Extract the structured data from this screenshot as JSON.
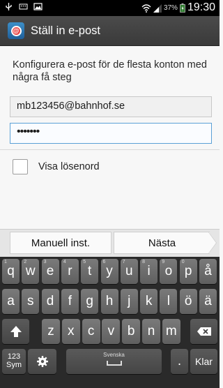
{
  "status_bar": {
    "battery": "37%",
    "time": "19:30"
  },
  "action_bar": {
    "title": "Ställ in e-post",
    "app_icon": "email-app-icon"
  },
  "content": {
    "intro": "Konfigurera e-post för de flesta konton med några få steg",
    "email_value": "mb123456@bahnhof.se",
    "password_value": "•••••••",
    "show_password_label": "Visa lösenord"
  },
  "buttons": {
    "manual": "Manuell inst.",
    "next": "Nästa"
  },
  "keyboard": {
    "row1": [
      {
        "label": "q",
        "num": "1"
      },
      {
        "label": "w",
        "num": "2"
      },
      {
        "label": "e",
        "num": "3"
      },
      {
        "label": "r",
        "num": "4"
      },
      {
        "label": "t",
        "num": "5"
      },
      {
        "label": "y",
        "num": "6"
      },
      {
        "label": "u",
        "num": "7"
      },
      {
        "label": "i",
        "num": "8"
      },
      {
        "label": "o",
        "num": "9"
      },
      {
        "label": "p",
        "num": "0"
      },
      {
        "label": "å",
        "num": ""
      }
    ],
    "row2": [
      "a",
      "s",
      "d",
      "f",
      "g",
      "h",
      "j",
      "k",
      "l",
      "ö",
      "ä"
    ],
    "row3": [
      "z",
      "x",
      "c",
      "v",
      "b",
      "n",
      "m"
    ],
    "sym_top": "123",
    "sym_bottom": "Sym",
    "space_label": "Svenska",
    "period": ".",
    "done": "Klar",
    "settings_icon": "gear-icon",
    "shift_icon": "shift-arrow-icon",
    "backspace_icon": "backspace-icon"
  }
}
